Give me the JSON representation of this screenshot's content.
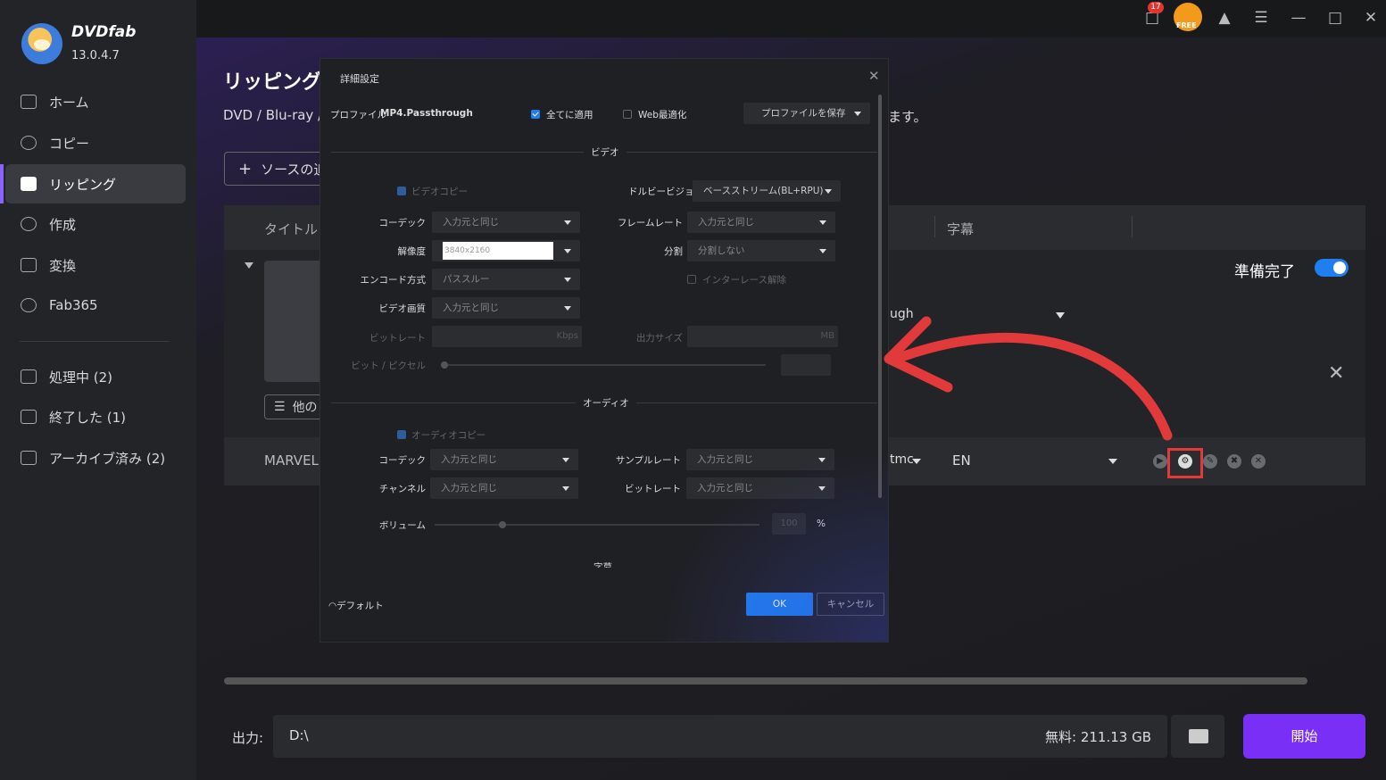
{
  "app": {
    "brand": "DVDfab",
    "version": "13.0.4.7",
    "notification_count": "17",
    "free_label": "FREE"
  },
  "sidebar": {
    "items": [
      {
        "label": "ホーム",
        "icon": "home-icon"
      },
      {
        "label": "コピー",
        "icon": "copy-icon"
      },
      {
        "label": "リッピング",
        "icon": "ripper-icon",
        "active": true
      },
      {
        "label": "作成",
        "icon": "creator-icon"
      },
      {
        "label": "変換",
        "icon": "converter-icon"
      },
      {
        "label": "Fab365",
        "icon": "fab365-icon"
      }
    ],
    "queue": [
      {
        "label": "処理中 (2)",
        "icon": "processing-icon"
      },
      {
        "label": "終了した (1)",
        "icon": "finished-icon"
      },
      {
        "label": "アーカイブ済み (2)",
        "icon": "archive-icon"
      }
    ]
  },
  "main": {
    "title": "リッピング",
    "description": "DVD / Blu-ray /",
    "description_tail": "ます。",
    "add_source": "ソースの追",
    "columns": {
      "title": "タイトル",
      "subtitle": "字幕"
    },
    "ready_label": "準備完了",
    "other_button": "他の",
    "profile_tail": "ugh",
    "row2": {
      "title": "MARVEL'",
      "audio": "tmc",
      "subtitle": "EN"
    }
  },
  "output": {
    "label": "出力:",
    "path": "D:\\",
    "free_space": "無料: 211.13 GB",
    "start": "開始"
  },
  "dialog": {
    "title": "詳細設定",
    "profile_label": "プロファイル",
    "profile_name": "MP4.Passthrough",
    "apply_all": "全てに適用",
    "web_optimize": "Web最適化",
    "save_profile": "プロファイルを保存",
    "video_section": "ビデオ",
    "video_copy": "ビデオコピー",
    "dolby_label": "ドルビービジョン",
    "dolby_value": "ベースストリーム(BL+RPU)",
    "codec_label": "コーデック",
    "codec_value": "入力元と同じ",
    "framerate_label": "フレームレート",
    "framerate_value": "入力元と同じ",
    "resolution_label": "解像度",
    "resolution_value": "3840x2160",
    "split_label": "分割",
    "split_value": "分割しない",
    "encode_label": "エンコード方式",
    "encode_value": "パススルー",
    "deinterlace": "インターレース解除",
    "quality_label": "ビデオ画質",
    "quality_value": "入力元と同じ",
    "bitrate_label": "ビットレート",
    "bitrate_unit": "Kbps",
    "outsize_label": "出力サイズ",
    "outsize_unit": "MB",
    "bpp_label": "ビット / ピクセル",
    "audio_section": "オーディオ",
    "audio_copy": "オーディオコピー",
    "a_codec_label": "コーデック",
    "a_codec_value": "入力元と同じ",
    "samplerate_label": "サンプルレート",
    "samplerate_value": "入力元と同じ",
    "channel_label": "チャンネル",
    "channel_value": "入力元と同じ",
    "a_bitrate_label": "ビットレート",
    "a_bitrate_value": "入力元と同じ",
    "volume_label": "ボリューム",
    "volume_value": "100",
    "volume_unit": "%",
    "subtitle_section": "字幕",
    "default": "デフォルト",
    "ok": "OK",
    "cancel": "キャンセル"
  },
  "colors": {
    "accent": "#1f7ef0",
    "start": "#7a2ff6",
    "highlight": "#e23a3a"
  }
}
